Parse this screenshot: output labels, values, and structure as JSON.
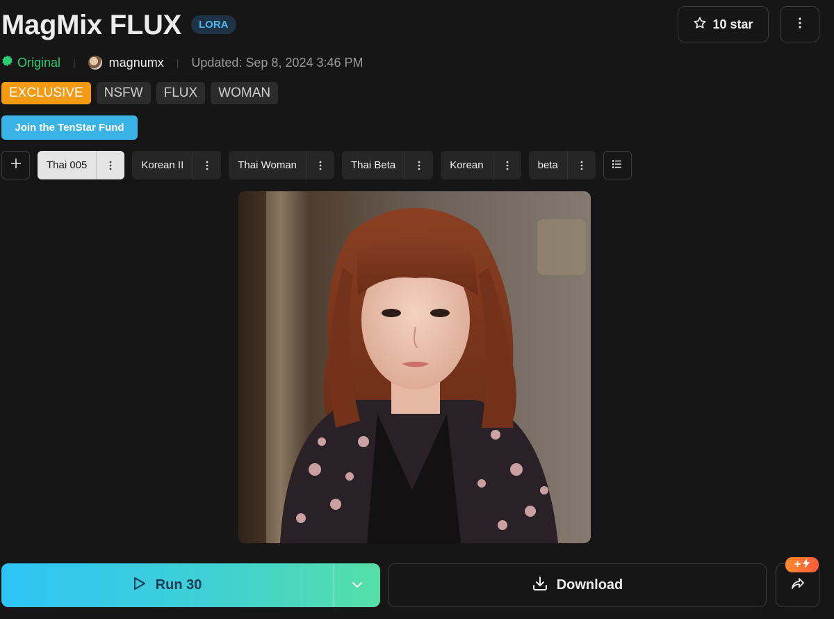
{
  "header": {
    "title": "MagMix FLUX",
    "type_badge": "LORA",
    "star_label": "10 star"
  },
  "meta": {
    "original_label": "Original",
    "author": "magnumx",
    "updated": "Updated: Sep 8, 2024 3:46 PM"
  },
  "tags": [
    "EXCLUSIVE",
    "NSFW",
    "FLUX",
    "WOMAN"
  ],
  "fund_button": "Join the TenStar Fund",
  "versions": [
    {
      "label": "Thai 005",
      "active": true
    },
    {
      "label": "Korean II",
      "active": false
    },
    {
      "label": "Thai Woman",
      "active": false
    },
    {
      "label": "Thai Beta",
      "active": false
    },
    {
      "label": "Korean",
      "active": false
    },
    {
      "label": "beta",
      "active": false
    }
  ],
  "actions": {
    "run_label": "Run 30",
    "download_label": "Download",
    "promo_badge": "+"
  },
  "colors": {
    "background": "#161616",
    "accent_cyan": "#3ab4e6",
    "original_green": "#2ecc71",
    "exclusive_orange": "#f59b12",
    "run_gradient_start": "#2ec4f6",
    "run_gradient_end": "#55dfa6"
  },
  "icons": {
    "star": "star-outline-icon",
    "more": "more-vertical-icon",
    "original": "verified-badge-icon",
    "add": "plus-icon",
    "list": "list-icon",
    "run": "play-icon",
    "run_dropdown": "chevron-down-icon",
    "download": "download-icon",
    "share": "share-icon",
    "promo": "lightning-icon"
  }
}
